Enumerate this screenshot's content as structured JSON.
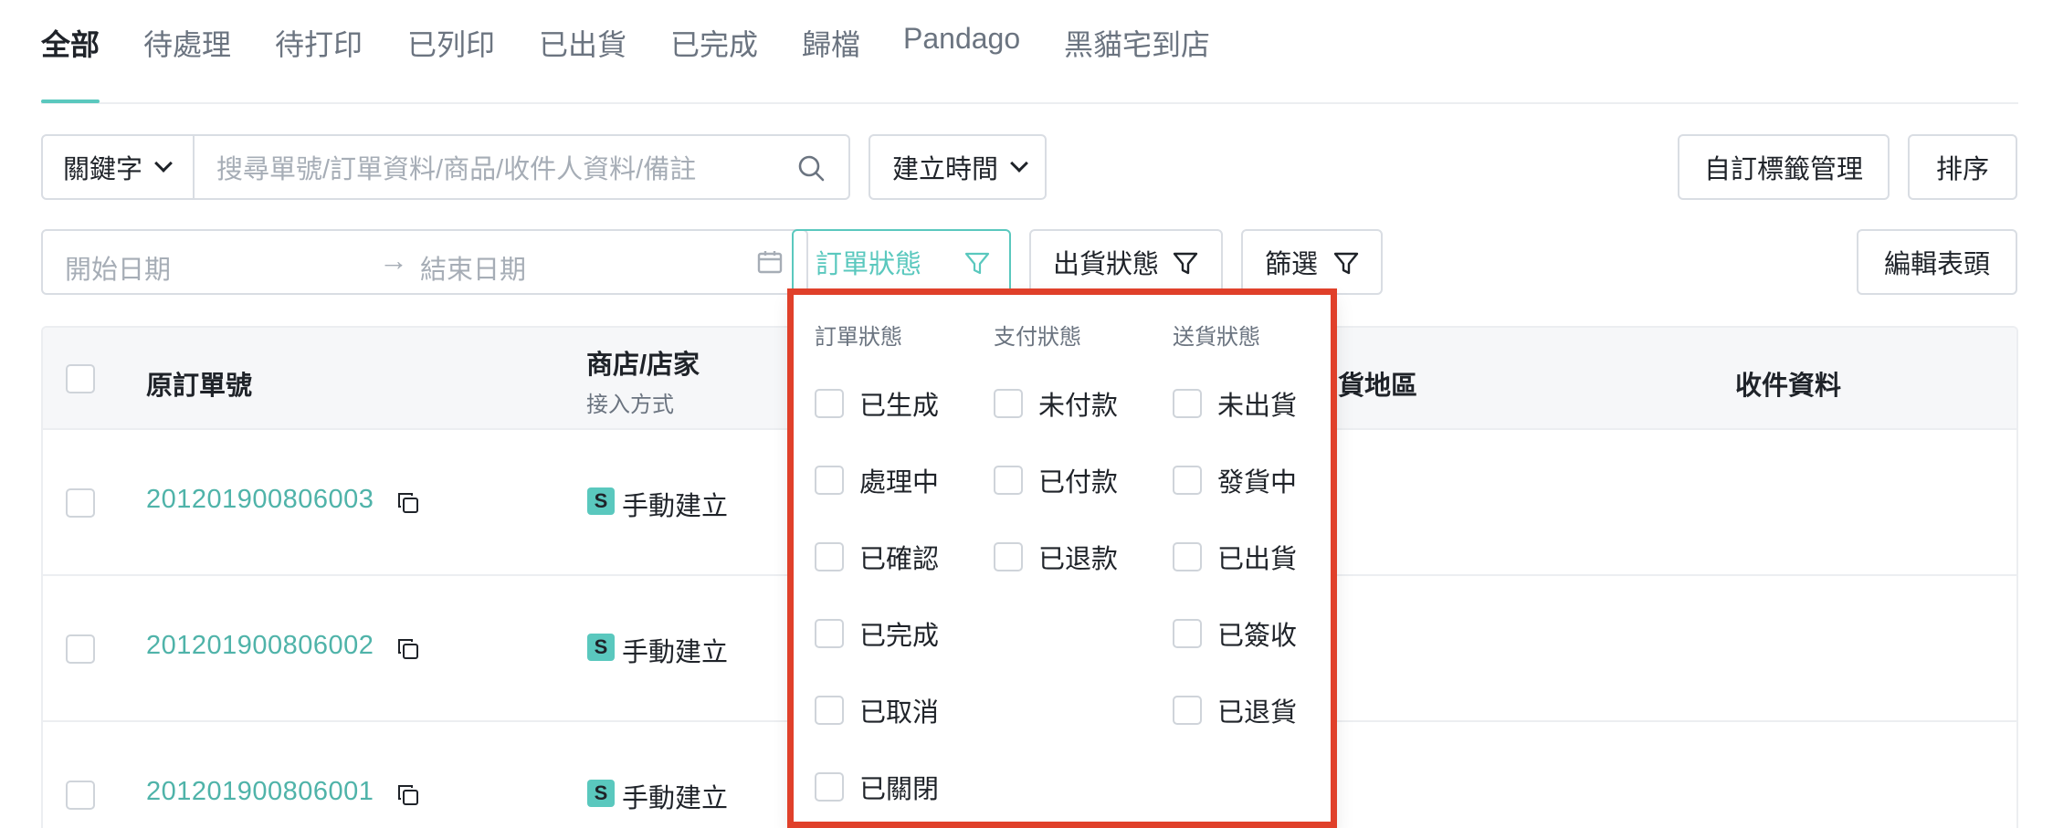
{
  "tabs": [
    {
      "label": "全部",
      "active": true
    },
    {
      "label": "待處理",
      "active": false
    },
    {
      "label": "待打印",
      "active": false
    },
    {
      "label": "已列印",
      "active": false
    },
    {
      "label": "已出貨",
      "active": false
    },
    {
      "label": "已完成",
      "active": false
    },
    {
      "label": "歸檔",
      "active": false
    },
    {
      "label": "Pandago",
      "active": false
    },
    {
      "label": "黑貓宅到店",
      "active": false
    }
  ],
  "search": {
    "keyword_select": "關鍵字",
    "placeholder": "搜尋單號/訂單資料/商品/收件人資料/備註",
    "time_select": "建立時間"
  },
  "date_range": {
    "start_placeholder": "開始日期",
    "separator": "→",
    "end_placeholder": "結束日期"
  },
  "filters": {
    "order_status": "訂單狀態",
    "shipping_status": "出貨狀態",
    "filter": "篩選"
  },
  "buttons": {
    "custom_tags": "自訂標籤管理",
    "sort": "排序",
    "edit_header": "編輯表頭"
  },
  "table": {
    "headers": {
      "order_no": "原訂單號",
      "store": "商店/店家",
      "store_sub": "接入方式",
      "region": "貨地區",
      "recipient": "收件資料"
    },
    "rows": [
      {
        "order_no": "201201900806003",
        "badge": "S",
        "method": "手動建立"
      },
      {
        "order_no": "201201900806002",
        "badge": "S",
        "method": "手動建立"
      },
      {
        "order_no": "201201900806001",
        "badge": "S",
        "method": "手動建立"
      }
    ]
  },
  "dropdown": {
    "columns": [
      {
        "heading": "訂單狀態",
        "options": [
          "已生成",
          "處理中",
          "已確認",
          "已完成",
          "已取消",
          "已關閉"
        ]
      },
      {
        "heading": "支付狀態",
        "options": [
          "未付款",
          "已付款",
          "已退款"
        ]
      },
      {
        "heading": "送貨狀態",
        "options": [
          "未出貨",
          "發貨中",
          "已出貨",
          "已簽收",
          "已退貨"
        ]
      }
    ]
  },
  "colors": {
    "accent": "#5ac8be",
    "highlight_border": "#e0402a"
  }
}
